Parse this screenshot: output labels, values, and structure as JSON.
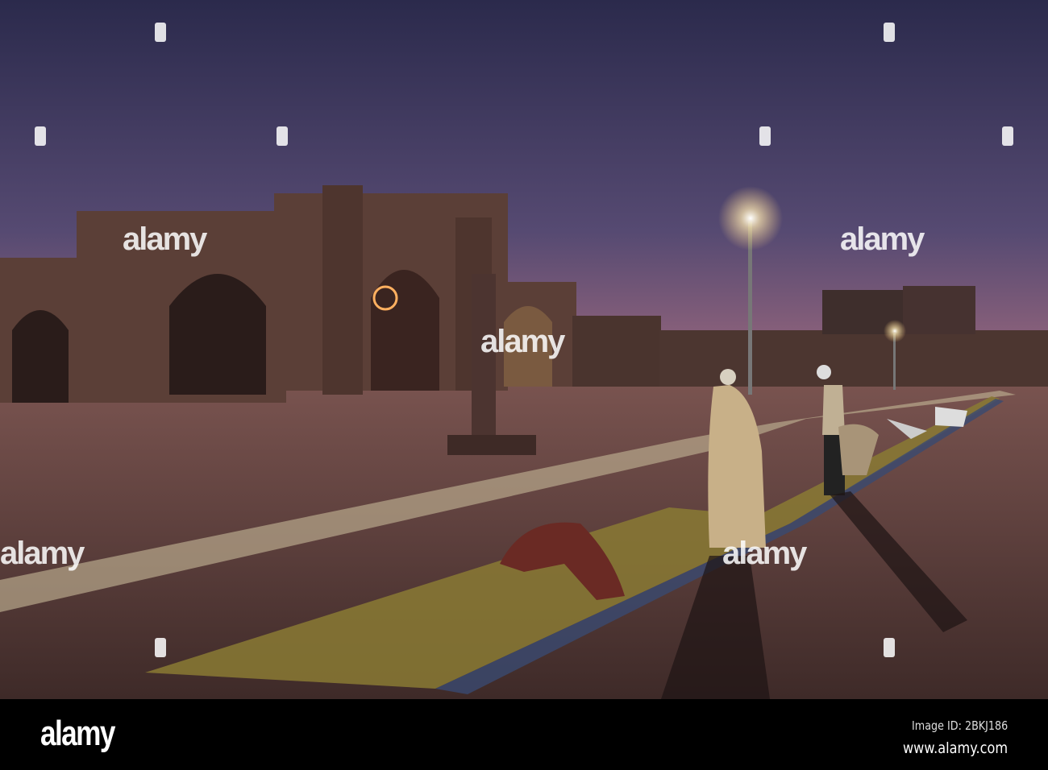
{
  "watermark": {
    "text": "alamy"
  },
  "footer": {
    "logo": "alamy",
    "image_id": "Image ID: 2BKJ186",
    "website": "www.alamy.com"
  },
  "colors": {
    "sky_top": "#2e2c4e",
    "sky_bottom": "#8a5a78",
    "stone": "#5a3e36",
    "floor": "#6e4a44",
    "footer_bg": "#000000"
  }
}
